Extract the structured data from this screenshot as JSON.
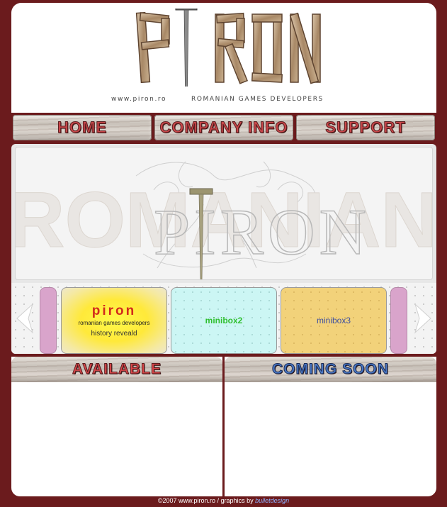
{
  "header": {
    "logo_text": "PIRON",
    "url": "www.piron.ro",
    "tagline": "ROMANIAN GAMES DEVELOPERS"
  },
  "nav": {
    "home": "HOME",
    "company": "COMPANY INFO",
    "support": "SUPPORT"
  },
  "banner": {
    "back_text": "ROMANIAN",
    "logo_text": "PIRON"
  },
  "carousel": {
    "minibox1": {
      "brand": "piron",
      "subtitle": "romanian games developers",
      "link": "history reveald"
    },
    "minibox2": {
      "label": "minibox2"
    },
    "minibox3": {
      "label": "minibox3"
    }
  },
  "panels": {
    "available": "AVAILABLE",
    "coming_soon": "COMING SOON"
  },
  "footer": {
    "text": "©2007 www.piron.ro / graphics by ",
    "link": "bulletdesign"
  },
  "colors": {
    "background": "#6b1b1d",
    "nav_text": "#c9474a",
    "coming_soon_text": "#4a78c6",
    "minibox1": "#fff94a",
    "minibox2": "#ccf6f4",
    "minibox3": "#f2d27a"
  }
}
